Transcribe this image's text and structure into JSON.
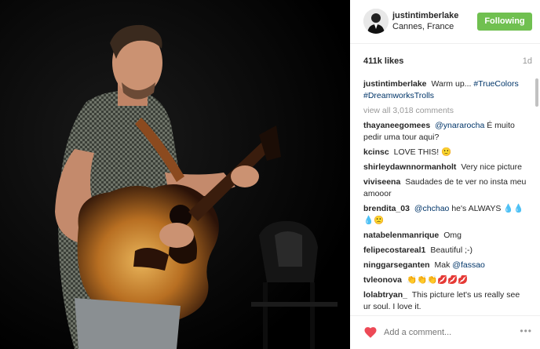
{
  "post": {
    "photo_alt": "man holding an acoustic guitar"
  },
  "header": {
    "username": "justintimberlake",
    "location": "Cannes, France",
    "follow_label": "Following"
  },
  "stats": {
    "likes": "411k likes",
    "age": "1d"
  },
  "caption": {
    "user": "justintimberlake",
    "text": "Warm up...",
    "tags": [
      "#TrueColors",
      "#DreamworksTrolls"
    ]
  },
  "view_all": "view all 3,018 comments",
  "comments": [
    {
      "user": "thayaneegomees",
      "mention": "@ynararocha",
      "text": "É muito pedir uma tour aqui?"
    },
    {
      "user": "kcinsc",
      "text": "LOVE THIS! 🙂"
    },
    {
      "user": "shirleydawnnormanholt",
      "text": "Very nice picture"
    },
    {
      "user": "viviseena",
      "text": "Saudades de te ver no insta meu amooor"
    },
    {
      "user": "brendita_03",
      "mention": "@chchao",
      "text": "he's ALWAYS 💧💧💧🙁"
    },
    {
      "user": "natabelenmanrique",
      "text": "Omg"
    },
    {
      "user": "felipecostareal1",
      "text": "Beautiful ;-)"
    },
    {
      "user": "ninggarseganten",
      "text": "Mak",
      "mention_after": "@fassao"
    },
    {
      "user": "tvleonova",
      "text": "👏👏👏💋💋💋"
    },
    {
      "user": "lolabtryan_",
      "text": "This picture let's us really see ur soul. I love it."
    }
  ],
  "footer": {
    "comment_placeholder": "Add a comment...",
    "more_label": "•••"
  },
  "colors": {
    "follow_bg": "#70c050",
    "link": "#003569",
    "heart": "#ed4956"
  }
}
